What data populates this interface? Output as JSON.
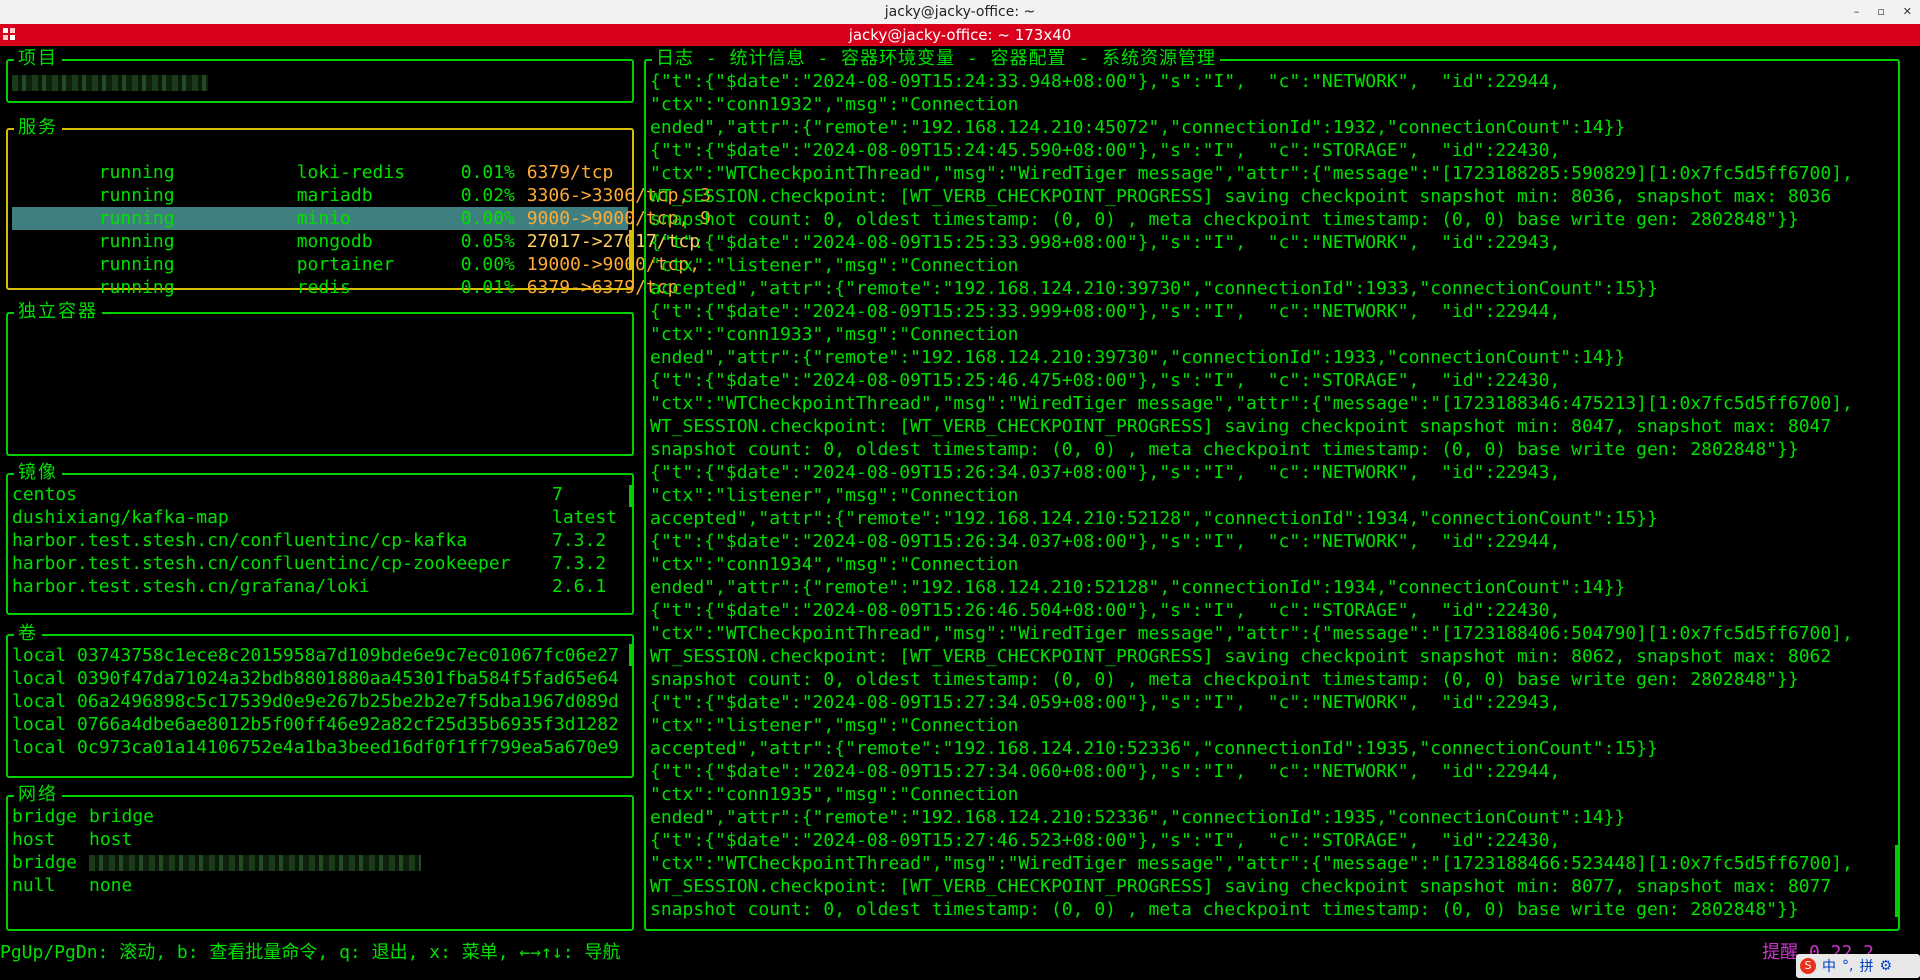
{
  "window": {
    "os_title": "jacky@jacky-office: ~",
    "terminal_title": "jacky@jacky-office: ~ 173x40",
    "controls": [
      "–",
      "▫",
      "✕"
    ]
  },
  "panels": {
    "project": {
      "title": "项目"
    },
    "services": {
      "title": "服务",
      "rows": [
        {
          "state": "running",
          "name": "loki-redis",
          "cpu": "0.01%",
          "ports": "6379/tcp"
        },
        {
          "state": "running",
          "name": "mariadb",
          "cpu": "0.02%",
          "ports": "3306->3306/tcp, 3"
        },
        {
          "state": "running",
          "name": "minio",
          "cpu": "0.00%",
          "ports": "9000->9000/tcp, 9"
        },
        {
          "state": "running",
          "name": "mongodb",
          "cpu": "0.05%",
          "ports": "27017->27017/tcp"
        },
        {
          "state": "running",
          "name": "portainer",
          "cpu": "0.00%",
          "ports": "19000->9000/tcp,"
        },
        {
          "state": "running",
          "name": "redis",
          "cpu": "0.01%",
          "ports": "6379->6379/tcp"
        }
      ]
    },
    "standalone": {
      "title": "独立容器"
    },
    "images": {
      "title": "镜像",
      "rows": [
        {
          "name": "centos",
          "tag": "7"
        },
        {
          "name": "dushixiang/kafka-map",
          "tag": "latest"
        },
        {
          "name": "harbor.test.stesh.cn/confluentinc/cp-kafka",
          "tag": "7.3.2"
        },
        {
          "name": "harbor.test.stesh.cn/confluentinc/cp-zookeeper",
          "tag": "7.3.2"
        },
        {
          "name": "harbor.test.stesh.cn/grafana/loki",
          "tag": "2.6.1"
        }
      ]
    },
    "volumes": {
      "title": "卷",
      "rows": [
        "local 03743758c1ece8c2015958a7d109bde6e9c7ec01067fc06e27",
        "local 0390f47da71024a32bdb8801880aa45301fba584f5fad65e64",
        "local 06a2496898c5c17539d0e9e267b25be2b2e7f5dba1967d089d",
        "local 0766a4dbe6ae8012b5f00ff46e92a82cf25d35b6935f3d1282",
        "local 0c973ca01a14106752e4a1ba3beed16df0f1ff799ea5a670e9"
      ]
    },
    "networks": {
      "title": "网络",
      "rows": [
        {
          "driver": "bridge",
          "name": "bridge"
        },
        {
          "driver": "host",
          "name": "host"
        },
        {
          "driver": "bridge",
          "name": ""
        },
        {
          "driver": "null",
          "name": "none"
        }
      ]
    }
  },
  "log_panel": {
    "title": "日志 - 统计信息 - 容器环境变量 - 容器配置 - 系统资源管理",
    "lines": [
      "{\"t\":{\"$date\":\"2024-08-09T15:24:33.948+08:00\"},\"s\":\"I\",  \"c\":\"NETWORK\",  \"id\":22944,",
      "\"ctx\":\"conn1932\",\"msg\":\"Connection",
      "ended\",\"attr\":{\"remote\":\"192.168.124.210:45072\",\"connectionId\":1932,\"connectionCount\":14}}",
      "{\"t\":{\"$date\":\"2024-08-09T15:24:45.590+08:00\"},\"s\":\"I\",  \"c\":\"STORAGE\",  \"id\":22430,",
      "\"ctx\":\"WTCheckpointThread\",\"msg\":\"WiredTiger message\",\"attr\":{\"message\":\"[1723188285:590829][1:0x7fc5d5ff6700],",
      "WT_SESSION.checkpoint: [WT_VERB_CHECKPOINT_PROGRESS] saving checkpoint snapshot min: 8036, snapshot max: 8036",
      "snapshot count: 0, oldest timestamp: (0, 0) , meta checkpoint timestamp: (0, 0) base write gen: 2802848\"}}",
      "{\"t\":{\"$date\":\"2024-08-09T15:25:33.998+08:00\"},\"s\":\"I\",  \"c\":\"NETWORK\",  \"id\":22943,",
      "\"ctx\":\"listener\",\"msg\":\"Connection",
      "accepted\",\"attr\":{\"remote\":\"192.168.124.210:39730\",\"connectionId\":1933,\"connectionCount\":15}}",
      "{\"t\":{\"$date\":\"2024-08-09T15:25:33.999+08:00\"},\"s\":\"I\",  \"c\":\"NETWORK\",  \"id\":22944,",
      "\"ctx\":\"conn1933\",\"msg\":\"Connection",
      "ended\",\"attr\":{\"remote\":\"192.168.124.210:39730\",\"connectionId\":1933,\"connectionCount\":14}}",
      "{\"t\":{\"$date\":\"2024-08-09T15:25:46.475+08:00\"},\"s\":\"I\",  \"c\":\"STORAGE\",  \"id\":22430,",
      "\"ctx\":\"WTCheckpointThread\",\"msg\":\"WiredTiger message\",\"attr\":{\"message\":\"[1723188346:475213][1:0x7fc5d5ff6700],",
      "WT_SESSION.checkpoint: [WT_VERB_CHECKPOINT_PROGRESS] saving checkpoint snapshot min: 8047, snapshot max: 8047",
      "snapshot count: 0, oldest timestamp: (0, 0) , meta checkpoint timestamp: (0, 0) base write gen: 2802848\"}}",
      "{\"t\":{\"$date\":\"2024-08-09T15:26:34.037+08:00\"},\"s\":\"I\",  \"c\":\"NETWORK\",  \"id\":22943,",
      "\"ctx\":\"listener\",\"msg\":\"Connection",
      "accepted\",\"attr\":{\"remote\":\"192.168.124.210:52128\",\"connectionId\":1934,\"connectionCount\":15}}",
      "{\"t\":{\"$date\":\"2024-08-09T15:26:34.037+08:00\"},\"s\":\"I\",  \"c\":\"NETWORK\",  \"id\":22944,",
      "\"ctx\":\"conn1934\",\"msg\":\"Connection",
      "ended\",\"attr\":{\"remote\":\"192.168.124.210:52128\",\"connectionId\":1934,\"connectionCount\":14}}",
      "{\"t\":{\"$date\":\"2024-08-09T15:26:46.504+08:00\"},\"s\":\"I\",  \"c\":\"STORAGE\",  \"id\":22430,",
      "\"ctx\":\"WTCheckpointThread\",\"msg\":\"WiredTiger message\",\"attr\":{\"message\":\"[1723188406:504790][1:0x7fc5d5ff6700],",
      "WT_SESSION.checkpoint: [WT_VERB_CHECKPOINT_PROGRESS] saving checkpoint snapshot min: 8062, snapshot max: 8062",
      "snapshot count: 0, oldest timestamp: (0, 0) , meta checkpoint timestamp: (0, 0) base write gen: 2802848\"}}",
      "{\"t\":{\"$date\":\"2024-08-09T15:27:34.059+08:00\"},\"s\":\"I\",  \"c\":\"NETWORK\",  \"id\":22943,",
      "\"ctx\":\"listener\",\"msg\":\"Connection",
      "accepted\",\"attr\":{\"remote\":\"192.168.124.210:52336\",\"connectionId\":1935,\"connectionCount\":15}}",
      "{\"t\":{\"$date\":\"2024-08-09T15:27:34.060+08:00\"},\"s\":\"I\",  \"c\":\"NETWORK\",  \"id\":22944,",
      "\"ctx\":\"conn1935\",\"msg\":\"Connection",
      "ended\",\"attr\":{\"remote\":\"192.168.124.210:52336\",\"connectionId\":1935,\"connectionCount\":14}}",
      "{\"t\":{\"$date\":\"2024-08-09T15:27:46.523+08:00\"},\"s\":\"I\",  \"c\":\"STORAGE\",  \"id\":22430,",
      "\"ctx\":\"WTCheckpointThread\",\"msg\":\"WiredTiger message\",\"attr\":{\"message\":\"[1723188466:523448][1:0x7fc5d5ff6700],",
      "WT_SESSION.checkpoint: [WT_VERB_CHECKPOINT_PROGRESS] saving checkpoint snapshot min: 8077, snapshot max: 8077",
      "snapshot count: 0, oldest timestamp: (0, 0) , meta checkpoint timestamp: (0, 0) base write gen: 2802848\"}}"
    ]
  },
  "status_bar": {
    "help": "PgUp/PgDn: 滚动, b: 查看批量命令, q: 退出, x: 菜单, ←→↑↓: 导航",
    "right": "提醒 0.22.2"
  },
  "tray": {
    "logo": "S",
    "items": [
      "中",
      "°,",
      "拼",
      "⚙"
    ]
  },
  "colors": {
    "fg": "#00e000",
    "border_green": "#00d000",
    "border_yellow": "#d8c000",
    "port": "#ffaa33",
    "selected_bg": "#3f7f7f",
    "title_bar": "#d8001b"
  }
}
